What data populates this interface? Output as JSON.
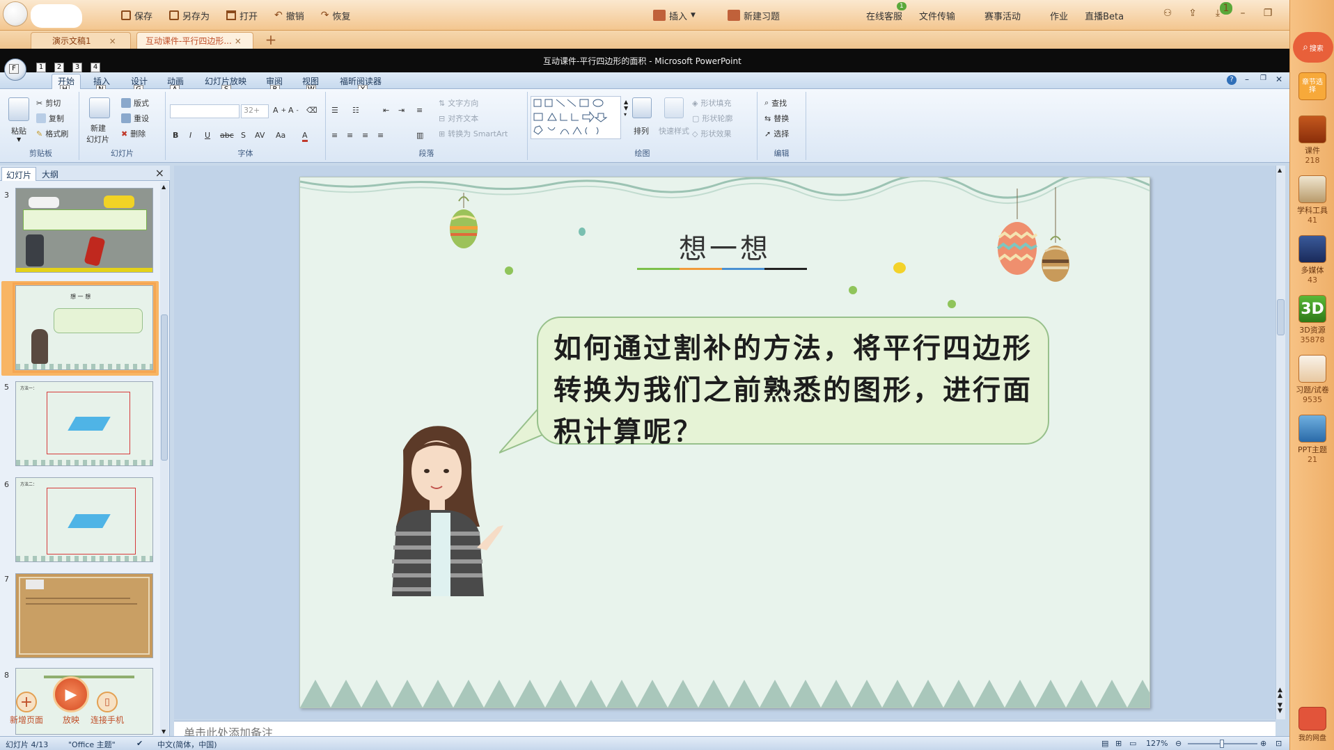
{
  "toolbar": {
    "save": "保存",
    "save_as": "另存为",
    "open": "打开",
    "undo": "撤销",
    "redo": "恢复",
    "insert": "插入",
    "new_exercise": "新建习题",
    "online_service": "在线客服",
    "file_transfer": "文件传输",
    "events": "赛事活动",
    "homework": "作业",
    "live": "直播Beta",
    "badge_service": "1",
    "badge_download": "1"
  },
  "doc_tabs": [
    {
      "label": "演示文稿1",
      "close": "×"
    },
    {
      "label": "互动课件-平行四边形...",
      "close": "×"
    }
  ],
  "window_title": "互动课件-平行四边形的面积 - Microsoft PowerPoint",
  "qat_keys": [
    "1",
    "2",
    "3",
    "4",
    "F"
  ],
  "ribbon_tabs": [
    {
      "label": "开始",
      "key": "H"
    },
    {
      "label": "插入",
      "key": "N"
    },
    {
      "label": "设计",
      "key": "G"
    },
    {
      "label": "动画",
      "key": "A"
    },
    {
      "label": "幻灯片放映",
      "key": "S"
    },
    {
      "label": "审阅",
      "key": "R"
    },
    {
      "label": "视图",
      "key": "W"
    },
    {
      "label": "福昕阅读器",
      "key": "Y"
    }
  ],
  "ribbon": {
    "clipboard": {
      "label": "剪贴板",
      "paste": "粘贴",
      "cut": "剪切",
      "copy": "复制",
      "format_painter": "格式刷"
    },
    "slides": {
      "label": "幻灯片",
      "new_slide": "新建",
      "new_slide2": "幻灯片",
      "layout": "版式",
      "reset": "重设",
      "delete": "删除"
    },
    "font": {
      "label": "字体",
      "size": "32+",
      "bold": "B",
      "italic": "I",
      "underline": "U",
      "strike": "abc",
      "shadow": "S",
      "spacing": "AV",
      "case": "Aa",
      "color": "A"
    },
    "paragraph": {
      "label": "段落",
      "text_direction": "文字方向",
      "align_text": "对齐文本",
      "smartart": "转换为 SmartArt"
    },
    "drawing": {
      "label": "绘图",
      "arrange": "排列",
      "quick_styles": "快速样式",
      "shape_fill": "形状填充",
      "shape_outline": "形状轮廓",
      "shape_effects": "形状效果"
    },
    "editing": {
      "label": "编辑",
      "find": "查找",
      "replace": "替换",
      "select": "选择"
    }
  },
  "panel": {
    "tab_slides": "幻灯片",
    "tab_outline": "大纲",
    "close": "×",
    "thumbnails": [
      {
        "num": "3"
      },
      {
        "num": "4",
        "title": "想 一 想"
      },
      {
        "num": "5",
        "label": "方法一："
      },
      {
        "num": "6",
        "label": "方法二："
      },
      {
        "num": "7"
      },
      {
        "num": "8"
      }
    ],
    "float": {
      "new_page": "新增页面",
      "play": "放映",
      "connect_phone": "连接手机"
    }
  },
  "slide": {
    "title": "想一想",
    "question": "如何通过割补的方法，将平行四边形转换为我们之前熟悉的图形，进行面积计算呢？"
  },
  "notes_placeholder": "单击此处添加备注",
  "status": {
    "slide_info": "幻灯片 4/13",
    "theme": "\"Office 主题\"",
    "language": "中文(简体，中国)",
    "zoom": "127%"
  },
  "sidebar": {
    "search": "搜索",
    "chapter": "章节选择",
    "items": [
      {
        "label": "课件",
        "count": "218"
      },
      {
        "label": "学科工具",
        "count": "41"
      },
      {
        "label": "多媒体",
        "count": "43"
      },
      {
        "label": "3D资源",
        "count": "35878"
      },
      {
        "label": "习题/试卷",
        "count": "9535"
      },
      {
        "label": "PPT主题",
        "count": "21"
      }
    ],
    "cloud": "我的网盘"
  },
  "colors": {
    "accent_orange": "#f3c68f",
    "ribbon_blue": "#dbe7f5",
    "slide_bg": "#e8f3ec",
    "bubble_fill": "#e6f3d6",
    "bubble_border": "#97c08b"
  }
}
